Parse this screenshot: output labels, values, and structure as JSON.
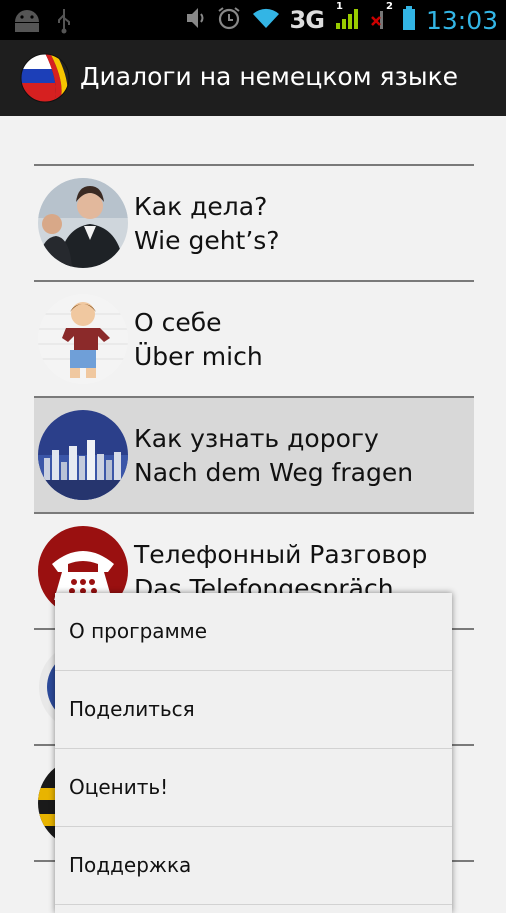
{
  "status_bar": {
    "network": "3G",
    "sim1_label": "1",
    "sim2_label": "2",
    "time": "13:03",
    "icons": [
      "android-icon",
      "usb-icon",
      "vibrate-icon",
      "alarm-icon",
      "wifi-icon",
      "signal-icon",
      "no-signal-icon",
      "battery-icon"
    ]
  },
  "action_bar": {
    "title": "Диалоги на немецком языке",
    "icon": "app-flag-icon"
  },
  "list": {
    "items": [
      {
        "ru": "Как дела?",
        "de": "Wie geht’s?",
        "image": "business-people-photo",
        "selected": false
      },
      {
        "ru": "О себе",
        "de": "Über mich",
        "image": "boy-cartoon",
        "selected": false
      },
      {
        "ru": "Как узнать дорогу",
        "de": "Nach dem Weg fragen",
        "image": "city-skyline-photo",
        "selected": true
      },
      {
        "ru": "Телефонный Разговор",
        "de": "Das Telefongespräch",
        "image": "red-telephone-icon",
        "selected": false
      }
    ]
  },
  "menu": {
    "items": [
      {
        "label": "О программе"
      },
      {
        "label": "Поделиться"
      },
      {
        "label": "Оценить!"
      },
      {
        "label": "Поддержка"
      }
    ]
  }
}
